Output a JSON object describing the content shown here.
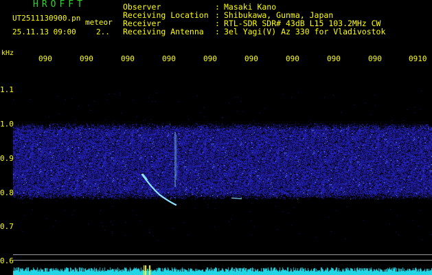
{
  "header": {
    "title": "HROFFT",
    "file_name": "UT2511130900.pn",
    "mode": "meteor",
    "date_time": "25.11.13 09:00",
    "speed": "2..",
    "info": [
      {
        "key": "Observer",
        "value": "Masaki Kano"
      },
      {
        "key": "Receiving Location",
        "value": "Shibukawa, Gunma, Japan"
      },
      {
        "key": "Receiver",
        "value": "RTL-SDR SDR# 43dB L15 103.2MHz CW"
      },
      {
        "key": "Receiving Antenna",
        "value": "3el Yagi(V) Az 330 for Vladivostok"
      }
    ],
    "separator": ":"
  },
  "axes": {
    "unit": "kHz",
    "time_ticks": [
      "090",
      "090",
      "090",
      "090",
      "090",
      "090",
      "090",
      "090",
      "090",
      "0910"
    ],
    "freq_ticks": [
      "1.1",
      "1.0",
      "0.9",
      "0.8",
      "0.7",
      "0.6"
    ]
  },
  "colors": {
    "background": "#000000",
    "title": "#2fd42f",
    "text": "#ffff00",
    "noise": "#2828c8",
    "echo": "#8fe4ff",
    "waveform": "#22d6e6",
    "waveform_peak": "#ffff33",
    "guide": "#9a9a9a"
  }
}
